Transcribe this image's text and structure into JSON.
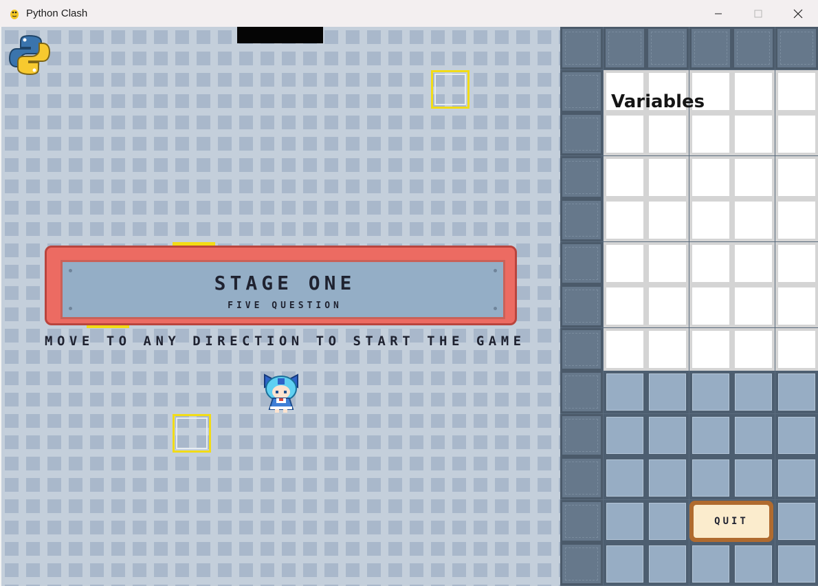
{
  "window": {
    "title": "Python Clash",
    "app_icon": "python-snake-icon",
    "controls": [
      "minimize-icon",
      "maximize-icon",
      "close-icon"
    ]
  },
  "game": {
    "stage_title": "STAGE ONE",
    "stage_subtitle": "FIVE QUESTION",
    "instruction": "MOVE TO ANY DIRECTION TO START THE GAME",
    "logo": "python-logo-icon",
    "player": "player-character-sprite"
  },
  "panel": {
    "variables_title": "Variables",
    "quit_label": "QUIT"
  },
  "colors": {
    "banner_red": "#ec6b62",
    "banner_inner": "#94aec6",
    "yellow_frame": "#f2dc16",
    "quit_border": "#b06b2f",
    "quit_fill": "#fbeccd"
  }
}
